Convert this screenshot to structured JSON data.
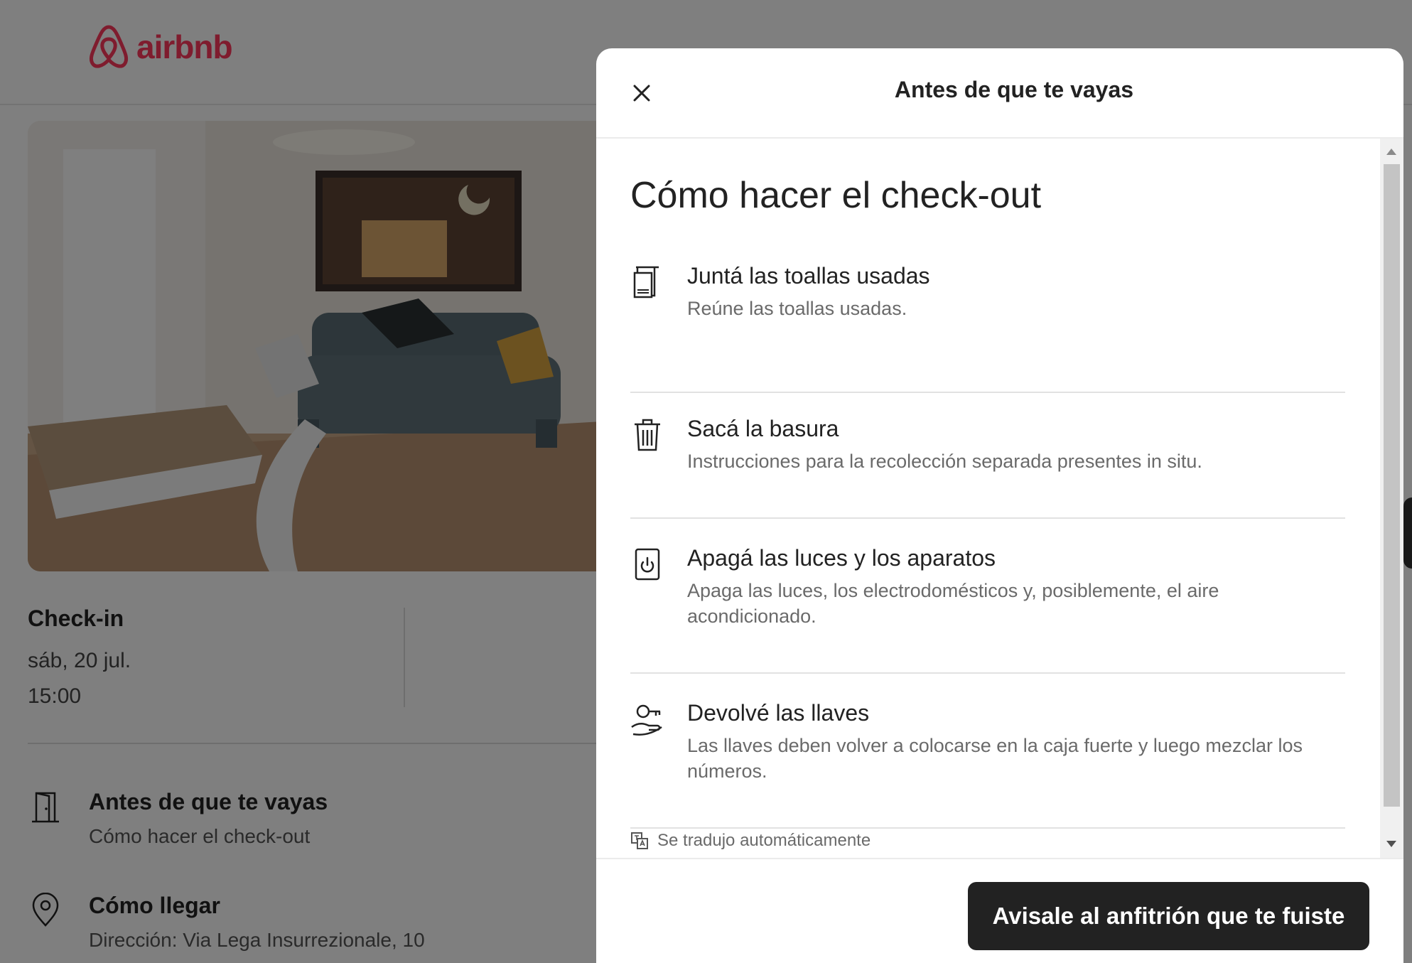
{
  "header": {
    "logo_text": "airbnb"
  },
  "listing": {
    "photo_dots": 5,
    "checkin": {
      "label": "Check-in",
      "date": "sáb, 20 jul.",
      "time": "15:00"
    },
    "items": [
      {
        "title": "Antes de que te vayas",
        "subtitle": "Cómo hacer el check-out",
        "icon": "door-icon"
      },
      {
        "title": "Cómo llegar",
        "subtitle": "Dirección: Via Lega Insurrezionale, 10",
        "icon": "location-pin-icon"
      }
    ]
  },
  "modal": {
    "title": "Antes de que te vayas",
    "heading": "Cómo hacer el check-out",
    "tasks": [
      {
        "title": "Juntá las toallas usadas",
        "desc": "Reúne las toallas usadas.",
        "icon": "towel-icon"
      },
      {
        "title": "Sacá la basura",
        "desc": "Instrucciones para la recolección separada presentes in situ.",
        "icon": "trash-icon"
      },
      {
        "title": "Apagá las luces y los aparatos",
        "desc": "Apaga las luces, los electrodomésticos y, posiblemente, el aire acondicionado.",
        "icon": "power-icon"
      },
      {
        "title": "Devolvé las llaves",
        "desc": "Las llaves deben volver a colocarse en la caja fuerte y luego mezclar los números.",
        "icon": "hand-key-icon"
      }
    ],
    "translated_note": "Se tradujo automáticamente",
    "primary_button": "Avisale al anfitrión que te fuiste"
  },
  "colors": {
    "brand": "#ff385c",
    "button": "#222222",
    "overlay": "rgba(0,0,0,0.5)"
  }
}
